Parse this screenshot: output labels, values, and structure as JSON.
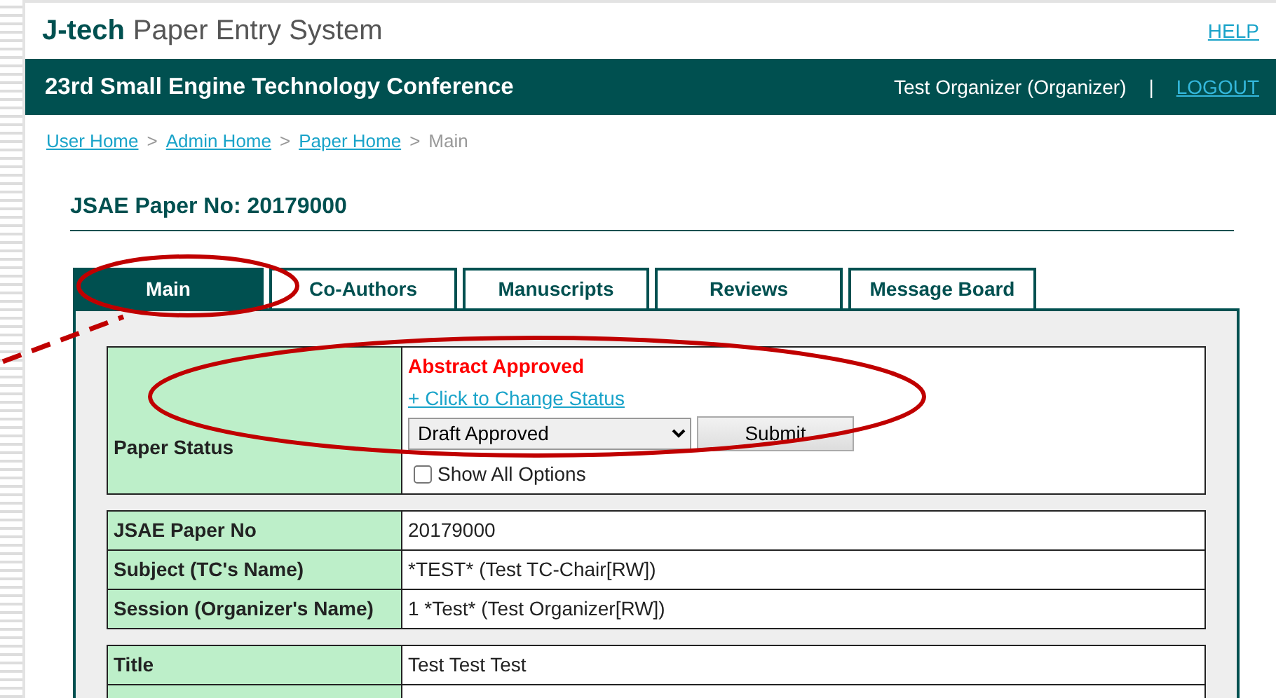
{
  "header": {
    "logo_brand": "J-tech",
    "logo_title": "Paper Entry System",
    "help_link": "HELP"
  },
  "conference_bar": {
    "title": "23rd Small Engine Technology Conference",
    "user": "Test Organizer (Organizer)",
    "separator": "|",
    "logout_link": "LOGOUT"
  },
  "breadcrumbs": [
    {
      "label": "User Home",
      "kind": "link",
      "separator": ">"
    },
    {
      "label": "Admin Home",
      "kind": "link",
      "separator": ">"
    },
    {
      "label": "Paper Home",
      "kind": "link",
      "separator": ">"
    },
    {
      "label": "Main",
      "kind": "current"
    }
  ],
  "paper_heading": "JSAE Paper No: 20179000",
  "tabs": [
    {
      "label": "Main",
      "selected": true
    },
    {
      "label": "Co-Authors",
      "selected": false
    },
    {
      "label": "Manuscripts",
      "selected": false
    },
    {
      "label": "Reviews",
      "selected": false
    },
    {
      "label": "Message Board",
      "selected": false
    }
  ],
  "status": {
    "label": "Paper Status",
    "current_status": "Abstract Approved",
    "change_link": "+ Click to Change Status",
    "status_select": "Draft Approved",
    "submit_button": "Submit",
    "show_all_options": {
      "label": "Show All Options",
      "checked": false
    }
  },
  "info_table": [
    {
      "label": "JSAE Paper No",
      "value": "20179000"
    },
    {
      "label": "Subject (TC's Name)",
      "value": "*TEST*  (Test TC-Chair[RW])"
    },
    {
      "label": "Session (Organizer's Name)",
      "value": "1 *Test*  (Test Organizer[RW])"
    }
  ],
  "title_table": [
    {
      "label": "Title",
      "value": "Test Test Test"
    }
  ]
}
